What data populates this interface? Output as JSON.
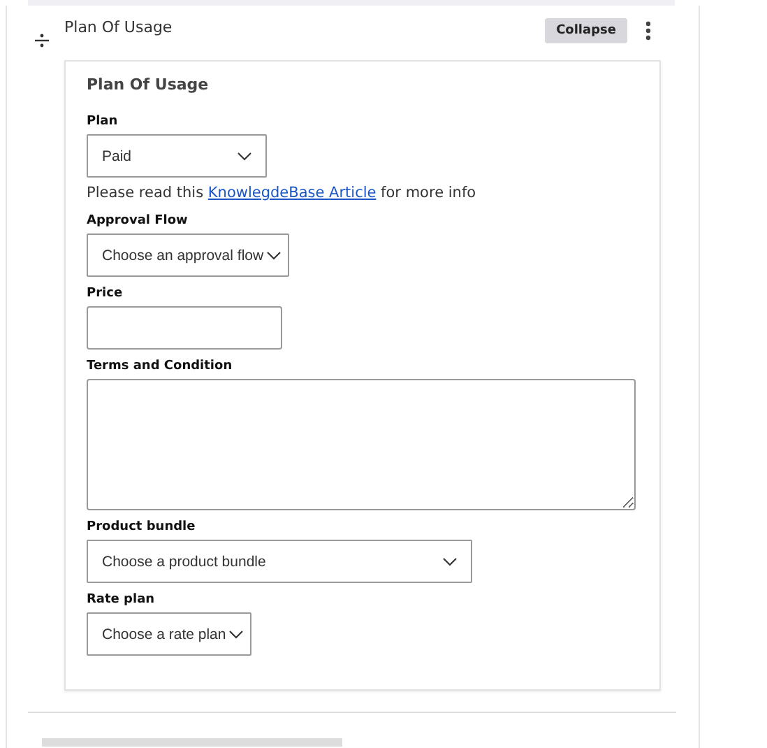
{
  "section": {
    "title": "Plan Of Usage",
    "collapse_button": "Collapse",
    "expanded": true
  },
  "card": {
    "title": "Plan Of Usage",
    "fields": [
      {
        "kind": "select",
        "label": "Plan",
        "value": "Paid"
      },
      {
        "kind": "note",
        "text": "Please read this ",
        "link": "KnowlegdeBase Article",
        "after": " for more info"
      },
      {
        "kind": "select",
        "label": "Approval Flow",
        "placeholder": "Choose an approval flow"
      },
      {
        "kind": "text",
        "label": "Price"
      },
      {
        "kind": "textarea",
        "label": "Terms and Condition"
      },
      {
        "kind": "select",
        "label": "Product bundle",
        "placeholder": "Choose a product bundle"
      },
      {
        "kind": "select",
        "label": "Rate plan",
        "placeholder": "Choose a rate plan"
      }
    ]
  }
}
